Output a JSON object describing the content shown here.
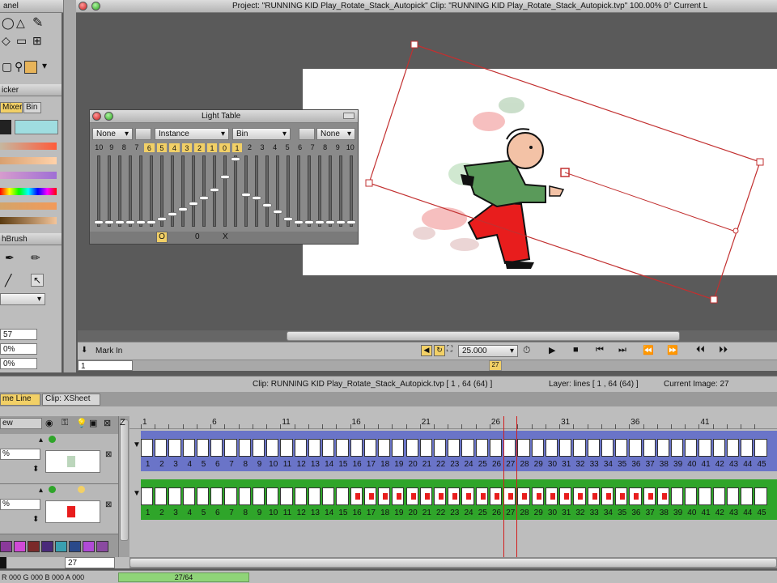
{
  "top_bar": {
    "project_info": "Project:  \"RUNNING KID Play_Rotate_Stack_Autopick\"  Clip:  \"RUNNING KID Play_Rotate_Stack_Autopick.tvp\"   100.00%   0°   Current L"
  },
  "left_panel": {
    "panel_title": "anel",
    "picker_title": "icker",
    "picker_tabs": [
      "Mixer",
      "Bin"
    ],
    "brush_title": "hBrush",
    "values": [
      "57",
      "0%",
      "0%"
    ]
  },
  "light_table": {
    "title": "Light Table",
    "dropdowns": [
      "None",
      "Instance",
      "Bin",
      "None"
    ],
    "left_numbers": [
      "10",
      "9",
      "8",
      "7"
    ],
    "highlight_left": [
      "6",
      "5",
      "4",
      "3",
      "2",
      "1",
      "0"
    ],
    "highlight_right": [
      "1"
    ],
    "right_numbers": [
      "2",
      "3",
      "4",
      "5",
      "6",
      "7",
      "8",
      "9",
      "10"
    ],
    "footer": [
      "O",
      "0",
      "X"
    ],
    "slider_levels": [
      0.05,
      0.05,
      0.05,
      0.05,
      0.05,
      0.05,
      0.1,
      0.17,
      0.24,
      0.32,
      0.4,
      0.52,
      0.72,
      0.98,
      0.45,
      0.4,
      0.3,
      0.2,
      0.1,
      0.05,
      0.05,
      0.05,
      0.05,
      0.05,
      0.05
    ]
  },
  "transport": {
    "mark_in": "Mark In",
    "frame_field": "1",
    "fps": "25.000",
    "playhead_label": "27"
  },
  "status": {
    "clip_info": "Clip: RUNNING KID Play_Rotate_Stack_Autopick.tvp   [ 1 , 64  (64) ]",
    "layer_info": "Layer: lines  [ 1 , 64  (64) ]",
    "current_image": "Current Image: 27"
  },
  "timeline_tabs": [
    "me Line",
    "Clip: XSheet"
  ],
  "timeline": {
    "layer_panel_label": "ew",
    "z_label": "Z",
    "layer1_value": "%",
    "layer2_value": "%",
    "current_frame_field": "27",
    "ruler_marks": [
      "1",
      "6",
      "11",
      "16",
      "21",
      "26",
      "31",
      "36",
      "41"
    ],
    "frames": [
      "1",
      "2",
      "3",
      "4",
      "5",
      "6",
      "7",
      "8",
      "9",
      "10",
      "11",
      "12",
      "13",
      "14",
      "15",
      "16",
      "17",
      "18",
      "19",
      "20",
      "21",
      "22",
      "23",
      "24",
      "25",
      "26",
      "27",
      "28",
      "29",
      "30",
      "31",
      "32",
      "33",
      "34",
      "35",
      "36",
      "37",
      "38",
      "39",
      "40",
      "41",
      "42",
      "43",
      "44",
      "45"
    ],
    "current_frame": 27
  },
  "bottom_status": {
    "rgb": "R 000 G 000 B 000 A 000",
    "progress": "27/64",
    "progress_fraction": 0.42
  },
  "colors": {
    "accent": "#f2d066",
    "green_track": "#2fa52a",
    "blue_track": "#6a74c8",
    "canvas_bg": "#ffffff",
    "workspace": "#5a5a5a"
  }
}
